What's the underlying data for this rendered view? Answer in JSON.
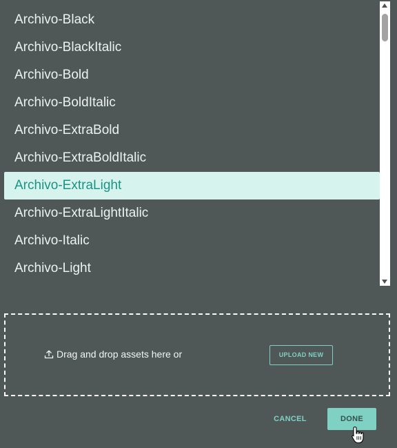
{
  "font_list": {
    "items": [
      {
        "label": "Archivo-Black"
      },
      {
        "label": "Archivo-BlackItalic"
      },
      {
        "label": "Archivo-Bold"
      },
      {
        "label": "Archivo-BoldItalic"
      },
      {
        "label": "Archivo-ExtraBold"
      },
      {
        "label": "Archivo-ExtraBoldItalic"
      },
      {
        "label": "Archivo-ExtraLight"
      },
      {
        "label": "Archivo-ExtraLightItalic"
      },
      {
        "label": "Archivo-Italic"
      },
      {
        "label": "Archivo-Light"
      }
    ],
    "selected_label": "Archivo-ExtraLight"
  },
  "dropzone": {
    "icon": "upload-icon",
    "text": "Drag and drop assets here or",
    "upload_label": "UPLOAD NEW"
  },
  "footer": {
    "cancel_label": "CANCEL",
    "done_label": "DONE"
  },
  "colors": {
    "background": "#4f5757",
    "accent": "#7fd1c4",
    "selected_bg": "#d7f3ee",
    "selected_text": "#1a9384"
  }
}
